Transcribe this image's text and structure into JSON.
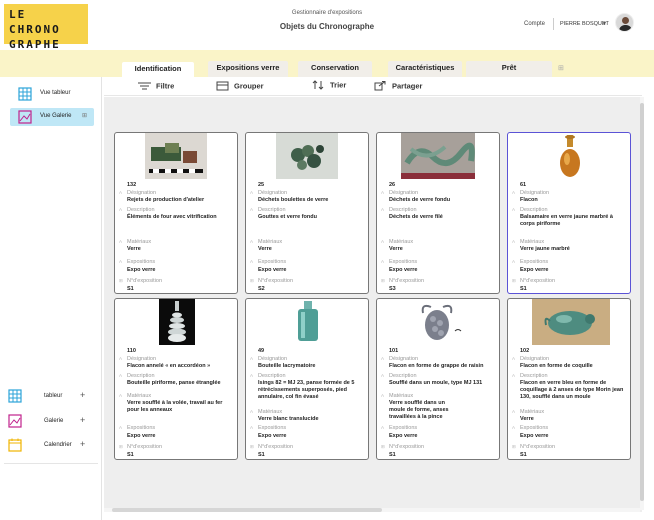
{
  "logo": {
    "line1": "LE",
    "line2": "CHRONO",
    "line3": "GRAPHE"
  },
  "header": {
    "subtitle": "Gestionnaire d'expositions",
    "title": "Objets du Chronographe",
    "account_label": "Compte",
    "user_name": "PIERRE BOSQUET",
    "caret": "▾"
  },
  "tabs": [
    {
      "label": "Identification",
      "active": true
    },
    {
      "label": "Expositions verre",
      "active": false
    },
    {
      "label": "Conservation",
      "active": false
    },
    {
      "label": "Caractéristiques",
      "active": false
    },
    {
      "label": "Prêt",
      "active": false
    }
  ],
  "tab_extra_icon": "pin-icon",
  "sidebar": {
    "views": [
      {
        "label": "Vue tableur",
        "icon": "grid-icon",
        "selected": false
      },
      {
        "label": "Vue Galerie",
        "icon": "gallery-icon",
        "selected": true
      }
    ],
    "bottom": [
      {
        "label": "tableur",
        "icon": "grid-icon",
        "color": "#2ba3d8"
      },
      {
        "label": "Galerie",
        "icon": "gallery-icon",
        "color": "#c0228c"
      },
      {
        "label": "Calendrier",
        "icon": "calendar-icon",
        "color": "#f0b400"
      }
    ],
    "plus": "+"
  },
  "toolbar": {
    "filter": "Filtre",
    "group": "Grouper",
    "sort": "Trier",
    "share": "Partager"
  },
  "field_labels": {
    "designation": "Désignation",
    "description": "Description",
    "materials": "Matériaux",
    "exhibitions": "Expositions",
    "exhibition_no": "N°d'exposition"
  },
  "cards": [
    {
      "num": "132",
      "designation": "Rejets de production d'atelier",
      "description": "Éléments de four avec vitrification",
      "materials": "Verre",
      "exhibitions": "Expo verre",
      "exhibition_no": "S1"
    },
    {
      "num": "25",
      "designation": "Déchets boulettes de verre",
      "description": "Gouttes et verre fondu",
      "materials": "Verre",
      "exhibitions": "Expo verre",
      "exhibition_no": "S2"
    },
    {
      "num": "26",
      "designation": "Déchets de verre fondu",
      "description": "Déchets de verre filé",
      "materials": "Verre",
      "exhibitions": "Expo verre",
      "exhibition_no": "S3"
    },
    {
      "num": "61",
      "designation": "Flacon",
      "description": "Balsamaire en verre jaune marbré à corps piriforme",
      "materials": "Verre jaune marbré",
      "exhibitions": "Expo verre",
      "exhibition_no": "S1",
      "selected": true
    },
    {
      "num": "110",
      "designation": "Flacon annelé « en accordéon »",
      "description": "Bouteille piriforme, panse étranglée",
      "materials": "Verre soufflé à la volée, travail au fer pour les anneaux",
      "exhibitions": "Expo verre",
      "exhibition_no": "S1"
    },
    {
      "num": "49",
      "designation": "Bouteille lacrymatoire",
      "description": "Isings 82 = MJ 23, panse formée de 5 rétrécissements superposés, pied annulaire, col fin évasé",
      "materials": "Verre blanc translucide",
      "exhibitions": "Expo verre",
      "exhibition_no": "S1"
    },
    {
      "num": "101",
      "designation": "Flacon en forme de grappe de raisin",
      "description": "Soufflé dans un moule, type MJ 131",
      "materials": "Verre soufflé dans un moule de forme, anses travaillées à la pince",
      "exhibitions": "Expo verre",
      "exhibition_no": "S1"
    },
    {
      "num": "102",
      "designation": "Flacon en forme de coquille",
      "description": "Flacon en verre bleu en forme de coquillage à 2 anses de type Morin jean 130, soufflé dans un moule",
      "materials": "Verre",
      "exhibitions": "Expo verre",
      "exhibition_no": "S1"
    }
  ]
}
